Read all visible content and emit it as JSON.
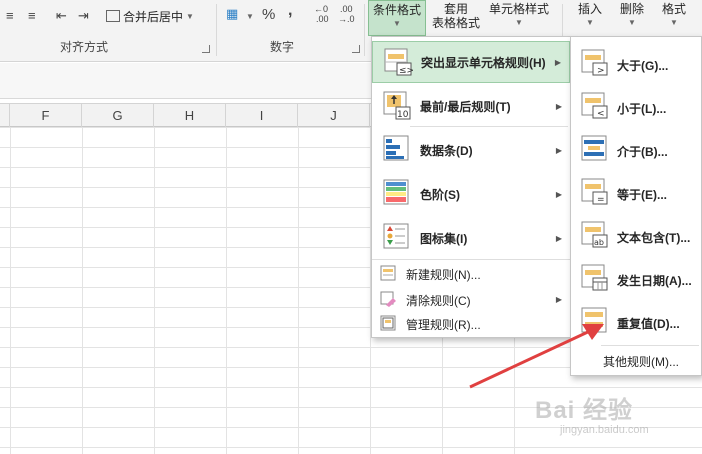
{
  "ribbon": {
    "align_group_label": "对齐方式",
    "merge_label": "合并后居中",
    "number_group_label": "数字",
    "percent_symbol": "%",
    "comma_symbol": ",",
    "dec_increase": "←0",
    "dec_increase_sub": ".00",
    "dec_decrease": ".00",
    "dec_decrease_sub": "→.0",
    "cond_format_label": "条件格式",
    "table_format_line1": "套用",
    "table_format_line2": "表格格式",
    "cell_styles_label": "单元格样式",
    "insert_label": "插入",
    "delete_label": "删除",
    "format_label": "格式"
  },
  "columns": [
    "F",
    "G",
    "H",
    "I",
    "J"
  ],
  "menu": {
    "highlight_rules": "突出显示单元格规则(H)",
    "top_bottom_rules": "最前/最后规则(T)",
    "data_bars": "数据条(D)",
    "color_scales": "色阶(S)",
    "icon_sets": "图标集(I)",
    "new_rule": "新建规则(N)...",
    "clear_rules": "清除规则(C)",
    "manage_rules": "管理规则(R)..."
  },
  "submenu": {
    "greater_than": "大于(G)...",
    "less_than": "小于(L)...",
    "between": "介于(B)...",
    "equal_to": "等于(E)...",
    "text_contains": "文本包含(T)...",
    "date_occurring": "发生日期(A)...",
    "duplicate_values": "重复值(D)...",
    "more_rules": "其他规则(M)..."
  },
  "watermark": {
    "text": "Bai 经验",
    "sub": "jingyan.baidu.com"
  },
  "colors": {
    "cond_btn_bg": "#c5e3cc",
    "menu_highlight": "#d4ecd9",
    "annotation_arrow": "#e04040"
  }
}
